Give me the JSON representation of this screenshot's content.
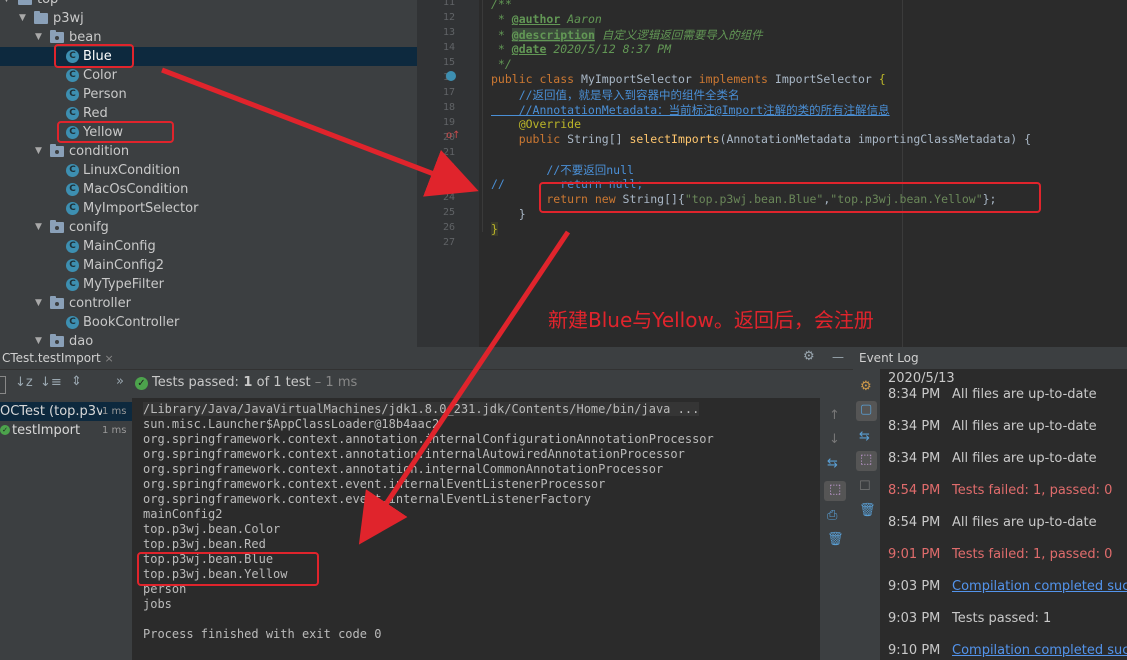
{
  "project_tree": {
    "items": [
      {
        "label": "top",
        "kind": "folder",
        "depth": 0,
        "expanded": true
      },
      {
        "label": "p3wj",
        "kind": "folder",
        "depth": 1,
        "expanded": true
      },
      {
        "label": "bean",
        "kind": "folder",
        "depth": 2,
        "expanded": true
      },
      {
        "label": "Blue",
        "kind": "class",
        "depth": 3,
        "selected": true
      },
      {
        "label": "Color",
        "kind": "class",
        "depth": 3
      },
      {
        "label": "Person",
        "kind": "class",
        "depth": 3
      },
      {
        "label": "Red",
        "kind": "class",
        "depth": 3
      },
      {
        "label": "Yellow",
        "kind": "class",
        "depth": 3
      },
      {
        "label": "condition",
        "kind": "folder",
        "depth": 2,
        "expanded": true
      },
      {
        "label": "LinuxCondition",
        "kind": "class",
        "depth": 3
      },
      {
        "label": "MacOsCondition",
        "kind": "class",
        "depth": 3
      },
      {
        "label": "MyImportSelector",
        "kind": "class",
        "depth": 3
      },
      {
        "label": "conifg",
        "kind": "folder",
        "depth": 2,
        "expanded": true
      },
      {
        "label": "MainConfig",
        "kind": "class",
        "depth": 3
      },
      {
        "label": "MainConfig2",
        "kind": "class",
        "depth": 3
      },
      {
        "label": "MyTypeFilter",
        "kind": "class",
        "depth": 3
      },
      {
        "label": "controller",
        "kind": "folder",
        "depth": 2,
        "expanded": true
      },
      {
        "label": "BookController",
        "kind": "class",
        "depth": 3
      },
      {
        "label": "dao",
        "kind": "folder",
        "depth": 2,
        "expanded": true
      }
    ],
    "class_icon_letter": "C"
  },
  "editor": {
    "line_numbers": [
      "11",
      "12",
      "13",
      "14",
      "15",
      "16",
      "17",
      "18",
      "19",
      "20",
      "21",
      "22",
      "23",
      "24",
      "25",
      "26",
      "27"
    ],
    "code": {
      "l11": "/**",
      "l12_prefix": " * ",
      "l12_tag": "@author",
      "l12_text": " Aaron",
      "l13_prefix": " * ",
      "l13_tag": "@description",
      "l13_text": " 自定义逻辑返回需要导入的组件",
      "l14_prefix": " * ",
      "l14_tag": "@date",
      "l14_text": " 2020/5/12 8:37 PM",
      "l15": " */",
      "l16_kw1": "public class",
      "l16_name": " MyImportSelector ",
      "l16_kw2": "implements",
      "l16_iface": " ImportSelector ",
      "l16_brace": "{",
      "l17": "    //返回值，就是导入到容器中的组件全类名",
      "l18": "    //AnnotationMetadata：当前标注@Import注解的类的所有注解信息",
      "l19": "    @Override",
      "l20_kw": "    public",
      "l20_type": " String[] ",
      "l20_method": "selectImports",
      "l20_rest": "(AnnotationMetadata importingClassMetadata) {",
      "l22": "        //不要返回null",
      "l23": "//        return null;",
      "l24_kw1": "        return new",
      "l24_type": " String[]{",
      "l24_s1": "\"top.p3wj.bean.Blue\"",
      "l24_comma": ",",
      "l24_s2": "\"top.p3wj.bean.Yellow\"",
      "l24_end": "};",
      "l25": "    }",
      "l26": "}"
    }
  },
  "annotation_text": "新建Blue与Yellow。返回后，会注册",
  "run_panel": {
    "tab_label": "CTest.testImport",
    "close_icon": "×",
    "status_text_prefix": "Tests passed:",
    "status_bold": " 1",
    "status_mid": " of 1 test",
    "status_time": " – 1 ms",
    "tests": [
      {
        "label": "OCTest (top.p3v",
        "time": "1 ms"
      },
      {
        "label": "testImport",
        "time": "1 ms"
      }
    ],
    "console_lines": [
      "/Library/Java/JavaVirtualMachines/jdk1.8.0_231.jdk/Contents/Home/bin/java ...",
      "sun.misc.Launcher$AppClassLoader@18b4aac2",
      "org.springframework.context.annotation.internalConfigurationAnnotationProcessor",
      "org.springframework.context.annotation.internalAutowiredAnnotationProcessor",
      "org.springframework.context.annotation.internalCommonAnnotationProcessor",
      "org.springframework.context.event.internalEventListenerProcessor",
      "org.springframework.context.event.internalEventListenerFactory",
      "mainConfig2",
      "top.p3wj.bean.Color",
      "top.p3wj.bean.Red",
      "top.p3wj.bean.Blue",
      "top.p3wj.bean.Yellow",
      "person",
      "jobs",
      "",
      "Process finished with exit code 0"
    ]
  },
  "event_log": {
    "title": "Event Log",
    "date": "2020/5/13",
    "entries": [
      {
        "time": "8:34 PM",
        "text": "All files are up-to-date",
        "style": "normal"
      },
      {
        "time": "8:34 PM",
        "text": "All files are up-to-date",
        "style": "normal"
      },
      {
        "time": "8:34 PM",
        "text": "All files are up-to-date",
        "style": "normal"
      },
      {
        "time": "8:54 PM",
        "text": "Tests failed: 1, passed: 0",
        "style": "red"
      },
      {
        "time": "8:54 PM",
        "text": "All files are up-to-date",
        "style": "normal"
      },
      {
        "time": "9:01 PM",
        "text": "Tests failed: 1, passed: 0",
        "style": "red"
      },
      {
        "time": "9:03 PM",
        "text": "Compilation completed succ",
        "style": "link"
      },
      {
        "time": "9:03 PM",
        "text": "Tests passed: 1",
        "style": "normal"
      },
      {
        "time": "9:10 PM",
        "text": "Compilation completed succ",
        "style": "link"
      }
    ]
  },
  "colors": {
    "highlight_red": "#e0242c",
    "selection": "#0d293e",
    "test_pass": "#4ca34c"
  }
}
